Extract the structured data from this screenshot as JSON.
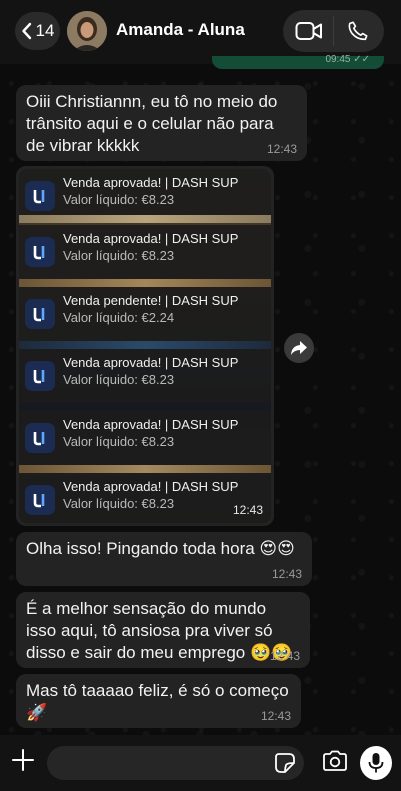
{
  "header": {
    "back_count": "14",
    "contact_name": "Amanda - Aluna"
  },
  "sent_tail": {
    "time_status": "09:45 ✓✓"
  },
  "messages": [
    {
      "text": "Oiii Christiannn, eu tô no meio do trânsito aqui e o celular não para de vibrar kkkkk",
      "time": "12:43"
    },
    {
      "text": "Olha isso! Pingando toda hora 😍😍",
      "time": "12:43"
    },
    {
      "text": "É a melhor sensação do mundo isso aqui, tô ansiosa pra viver só disso e sair do meu emprego 🥹🥹",
      "time": "12:43"
    },
    {
      "text": "Mas tô taaaao feliz, é só o começo 🚀",
      "time": "12:43"
    }
  ],
  "image_message": {
    "time": "12:43",
    "notifications": [
      {
        "title": "Venda aprovada! | DASH SUP",
        "value": "Valor líquido: €8.23"
      },
      {
        "title": "Venda aprovada! | DASH SUP",
        "value": "Valor líquido: €8.23"
      },
      {
        "title": "Venda pendente! | DASH SUP",
        "value": "Valor líquido: €2.24"
      },
      {
        "title": "Venda aprovada! | DASH SUP",
        "value": "Valor líquido: €8.23"
      },
      {
        "title": "Venda aprovada! | DASH SUP",
        "value": "Valor líquido: €8.23"
      },
      {
        "title": "Venda aprovada! | DASH SUP",
        "value": "Valor líquido: €8.23"
      }
    ]
  },
  "composer": {
    "placeholder": ""
  },
  "icons": [
    "chevron-left-icon",
    "video-call-icon",
    "phone-icon",
    "forward-icon",
    "plus-icon",
    "sticker-icon",
    "camera-icon",
    "microphone-icon",
    "dash-sup-logo-icon"
  ],
  "colors": {
    "incoming_bubble": "#232323",
    "outgoing_bubble": "#144d37",
    "bar": "#131313"
  }
}
